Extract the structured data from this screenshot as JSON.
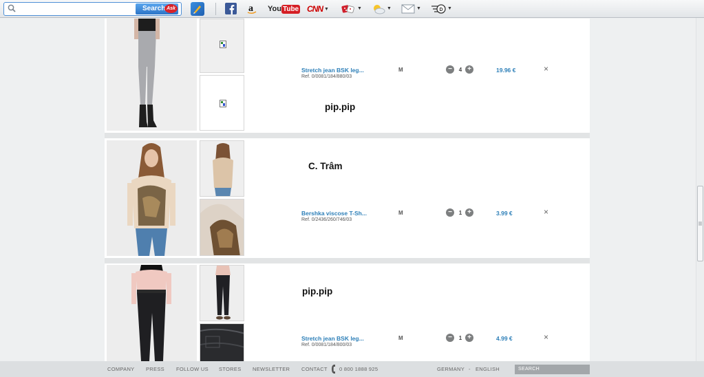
{
  "toolbar": {
    "search_placeholder": "",
    "search_button": "Search",
    "ask_badge": "Ask",
    "youtube_you": "You",
    "youtube_tube": "Tube",
    "cnn": "CNN"
  },
  "cart": {
    "items": [
      {
        "name": "Stretch jean BSK leg...",
        "ref": "Ref. 0/0081/184/880/03",
        "size": "M",
        "qty": "4",
        "price": "19.96 €",
        "remove": "×",
        "overlay": "pip.pip"
      },
      {
        "name": "Bershka viscose T-Sh...",
        "ref": "Ref. 0/2436/260/746/03",
        "size": "M",
        "qty": "1",
        "price": "3.99 €",
        "remove": "×",
        "overlay": "C. Trâm"
      },
      {
        "name": "Stretch jean BSK leg...",
        "ref": "Ref. 0/0081/184/800/03",
        "size": "M",
        "qty": "1",
        "price": "4.99 €",
        "remove": "×",
        "overlay": "pip.pip"
      }
    ],
    "minus": "−",
    "plus": "+"
  },
  "footer": {
    "links": [
      "COMPANY",
      "PRESS",
      "FOLLOW US",
      "STORES",
      "NEWSLETTER",
      "CONTACT"
    ],
    "phone": "0 800 1888 925",
    "country": "GERMANY",
    "dash": "-",
    "language": "ENGLISH",
    "search_placeholder": "SEARCH"
  },
  "colors": {
    "accent_blue": "#2d7fb8",
    "toolbar_search_blue": "#2c74c6",
    "footer_bg": "#dcdfe1"
  }
}
